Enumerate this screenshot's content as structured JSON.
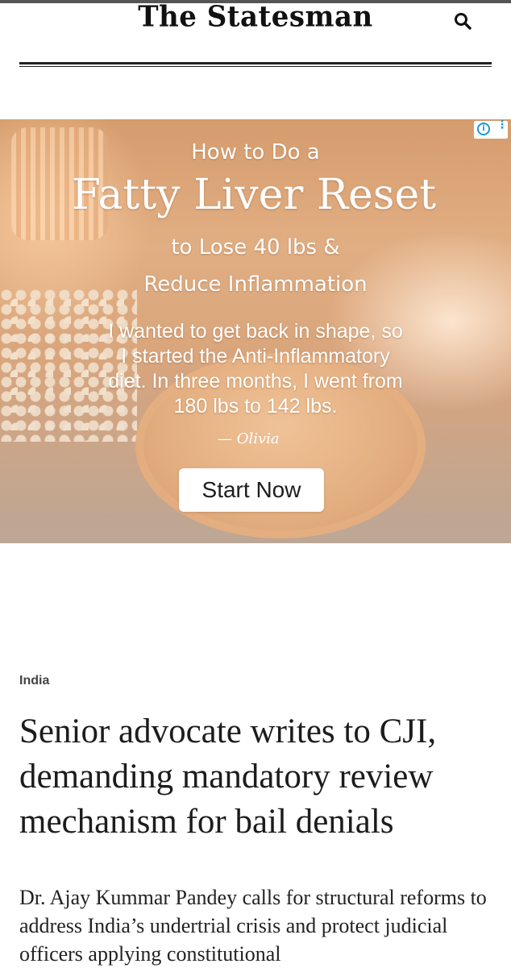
{
  "masthead": {
    "logo_text": "The Statesman"
  },
  "ad": {
    "line1": "How to Do a",
    "line2": "Fatty Liver Reset",
    "line3": "to Lose 40 lbs &",
    "line4": "Reduce Inflammation",
    "quote_line1": "I wanted to get back in shape, so",
    "quote_line2": "I started the Anti-Inflammatory",
    "quote_line3": "diet. In three months, I went from",
    "quote_line4": "180 lbs to 142 lbs.",
    "signature": "— Olivia",
    "cta_label": "Start Now",
    "info_glyph": "i",
    "more_glyph": "⋮",
    "icons": [
      "adchoices-info-icon",
      "ad-more-options-icon"
    ]
  },
  "article": {
    "section": "India",
    "headline": "Senior advocate writes to CJI, demanding mandatory review mechanism for bail denials",
    "summary": "Dr. Ajay Kummar Pandey calls for structural reforms to address India’s undertrial crisis and protect judicial officers applying constitutional"
  },
  "colors": {
    "accent": "#1a9ad6",
    "text": "#1c1c1c"
  }
}
